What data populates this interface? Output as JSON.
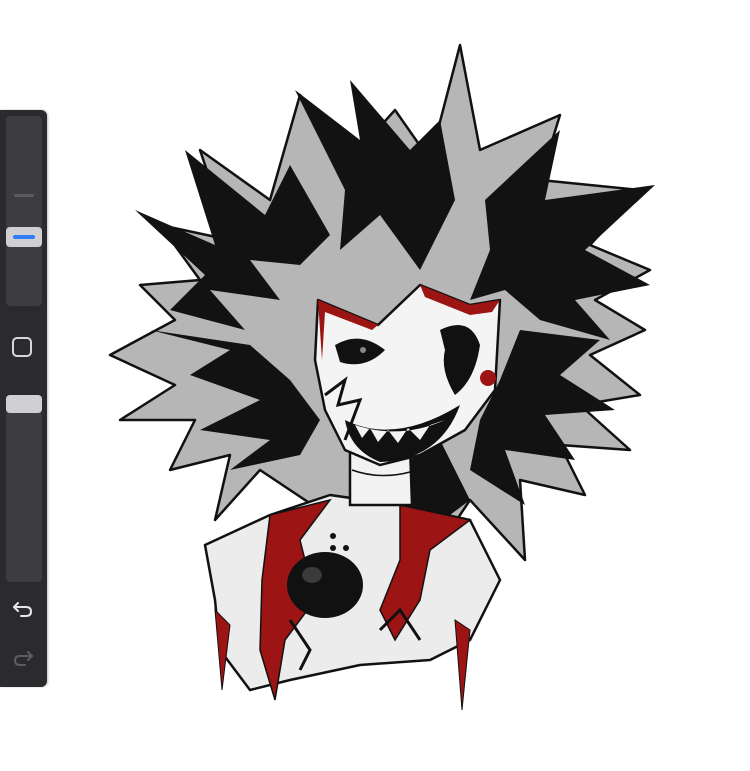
{
  "app": {
    "canvas_content": "illustration",
    "icons": {
      "modify": "square-modify-icon",
      "undo": "undo-icon",
      "redo": "redo-icon"
    },
    "colors": {
      "sidebar": "#2b2b2e",
      "track": "#3d3d41",
      "accent": "#2f7cf6",
      "handle": "#cfcfd4",
      "ink": "#111111",
      "gray": "#b3b3b3",
      "red": "#9c1414",
      "white": "#f4f4f4"
    }
  },
  "sidebar": {
    "brush_size": {
      "label": "",
      "level": 0.35
    },
    "brush_opacity": {
      "label": "",
      "level": 1.0
    },
    "undo_enabled": true,
    "redo_enabled": false
  }
}
